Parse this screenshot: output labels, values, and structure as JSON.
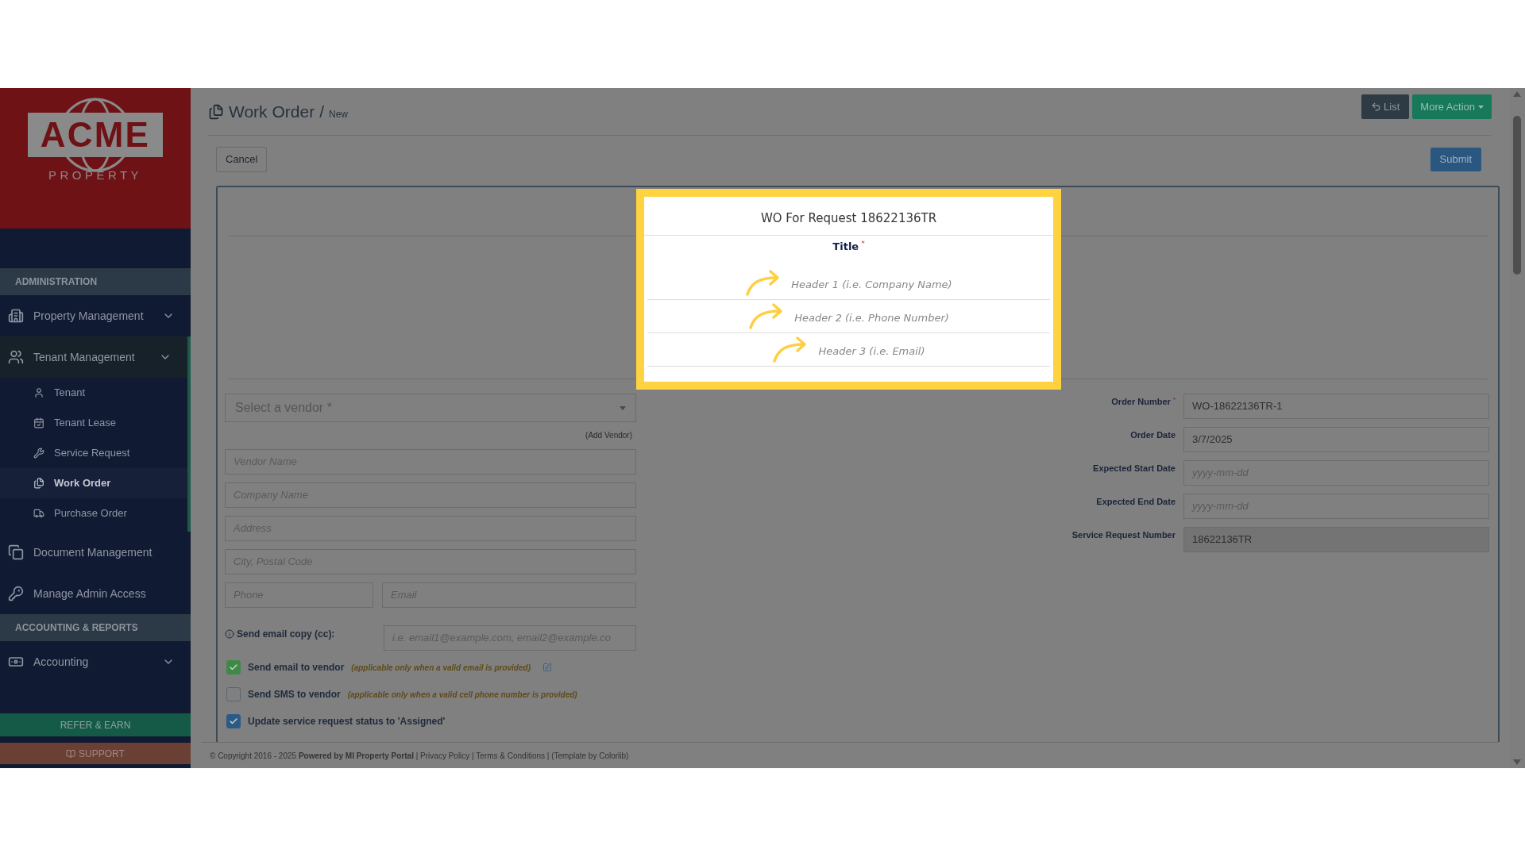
{
  "sidebar": {
    "logo": {
      "name": "ACME",
      "tagline": "PROPERTY"
    },
    "sections": [
      {
        "heading": "ADMINISTRATION",
        "items": [
          {
            "label": "Property Management",
            "collapsible": true,
            "expanded": false
          },
          {
            "label": "Tenant Management",
            "collapsible": true,
            "expanded": true,
            "children": [
              {
                "label": "Tenant",
                "selected": false
              },
              {
                "label": "Tenant Lease",
                "selected": false
              },
              {
                "label": "Service Request",
                "selected": false
              },
              {
                "label": "Work Order",
                "selected": true
              },
              {
                "label": "Purchase Order",
                "selected": false
              }
            ]
          },
          {
            "label": "Document Management",
            "collapsible": false
          },
          {
            "label": "Manage Admin Access",
            "collapsible": false
          }
        ]
      },
      {
        "heading": "ACCOUNTING & REPORTS",
        "items": [
          {
            "label": "Accounting",
            "collapsible": true,
            "expanded": false
          }
        ]
      }
    ],
    "refer_button": "REFER & EARN",
    "support_button": "SUPPORT"
  },
  "header": {
    "title": "Work Order",
    "separator": "/",
    "subtitle": "New",
    "list_button": "List",
    "more_button": "More Action"
  },
  "actions": {
    "cancel": "Cancel",
    "submit": "Submit"
  },
  "highlight": {
    "heading": "WO For Request 18622136TR",
    "title_label": "Title",
    "required_mark": "*",
    "headers": [
      {
        "placeholder": "Header 1 (i.e. Company Name)"
      },
      {
        "placeholder": "Header 2 (i.e. Phone Number)"
      },
      {
        "placeholder": "Header 3 (i.e. Email)"
      }
    ]
  },
  "vendor": {
    "select_placeholder": "Select a vendor *",
    "add_vendor": "(Add Vendor)",
    "fields": [
      {
        "placeholder": "Vendor Name"
      },
      {
        "placeholder": "Company Name"
      },
      {
        "placeholder": "Address"
      },
      {
        "placeholder": "City, Postal Code"
      }
    ],
    "phone_placeholder": "Phone",
    "email_placeholder": "Email",
    "cc_label": "Send email copy (cc):",
    "cc_placeholder": "i.e. email1@example.com, email2@example.co"
  },
  "options": [
    {
      "label": "Send email to vendor",
      "note": "(applicable only when a valid email is provided)",
      "checked": true,
      "color": "#3d8a46",
      "editable": true
    },
    {
      "label": "Send SMS to vendor",
      "note": "(applicable only when a valid cell phone number is provided)",
      "checked": false,
      "color": "#5c6570",
      "editable": false
    },
    {
      "label": "Update service request status to 'Assigned'",
      "checked": true,
      "color": "#2b5a86",
      "editable": false
    }
  ],
  "order": {
    "fields": [
      {
        "label": "Order Number",
        "mark": "*",
        "value": "WO-18622136TR-1",
        "disabled": false
      },
      {
        "label": "Order Date",
        "value": "3/7/2025",
        "disabled": false
      },
      {
        "label": "Expected Start Date",
        "placeholder": "yyyy-mm-dd",
        "disabled": false
      },
      {
        "label": "Expected End Date",
        "placeholder": "yyyy-mm-dd",
        "disabled": false
      },
      {
        "label": "Service Request Number",
        "value": "18622136TR",
        "disabled": true
      }
    ]
  },
  "footer": "© Copyright 2016 - 2025 **Powered by MI Property Portal** | Privacy Policy | Terms & Conditions | (Template by Colorlib)"
}
